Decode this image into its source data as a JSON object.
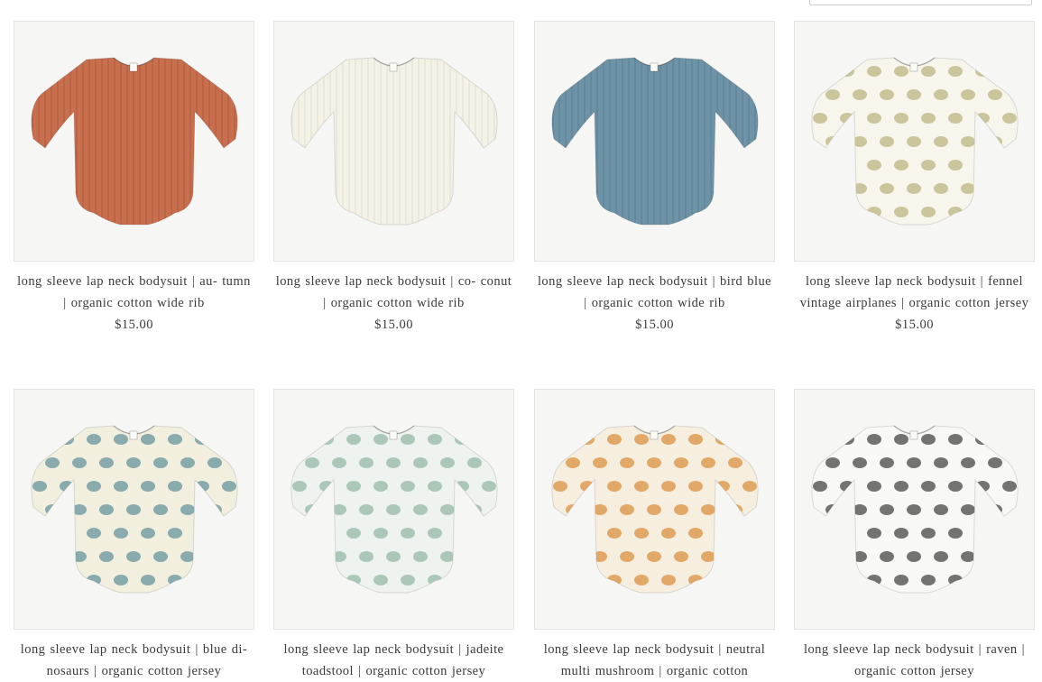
{
  "sort": {
    "value": ""
  },
  "products": [
    {
      "title": "long sleeve lap neck bodysuit | au- tumn | organic cotton wide rib",
      "price": "$15.00",
      "color": "#c86f4e",
      "pattern": "rib",
      "patternColor": "#a9553a"
    },
    {
      "title": "long sleeve lap neck bodysuit | co- conut | organic cotton wide rib",
      "price": "$15.00",
      "color": "#f4f1e7",
      "pattern": "rib",
      "patternColor": "#dcd7c8"
    },
    {
      "title": "long sleeve lap neck bodysuit | bird blue | organic cotton wide rib",
      "price": "$15.00",
      "color": "#6f93a6",
      "pattern": "rib",
      "patternColor": "#56798c"
    },
    {
      "title": "long sleeve lap neck bodysuit | fennel vintage airplanes | organic cotton jersey",
      "price": "$15.00",
      "color": "#f7f5ec",
      "pattern": "print",
      "patternColor": "#b8b07a"
    },
    {
      "title": "long sleeve lap neck bodysuit | blue di- nosaurs | organic cotton jersey",
      "price": "",
      "color": "#f2efdf",
      "pattern": "print",
      "patternColor": "#5d8e99"
    },
    {
      "title": "long sleeve lap neck bodysuit | jadeite toadstool | organic cotton jersey",
      "price": "",
      "color": "#eef3ef",
      "pattern": "print",
      "patternColor": "#8fb3a0"
    },
    {
      "title": "long sleeve lap neck bodysuit | neutral multi mushroom | organic cotton",
      "price": "",
      "color": "#f6efe0",
      "pattern": "print",
      "patternColor": "#d98a35"
    },
    {
      "title": "long sleeve lap neck bodysuit | raven | organic cotton jersey",
      "price": "",
      "color": "#f8f8f6",
      "pattern": "print",
      "patternColor": "#3a3a3a"
    }
  ]
}
